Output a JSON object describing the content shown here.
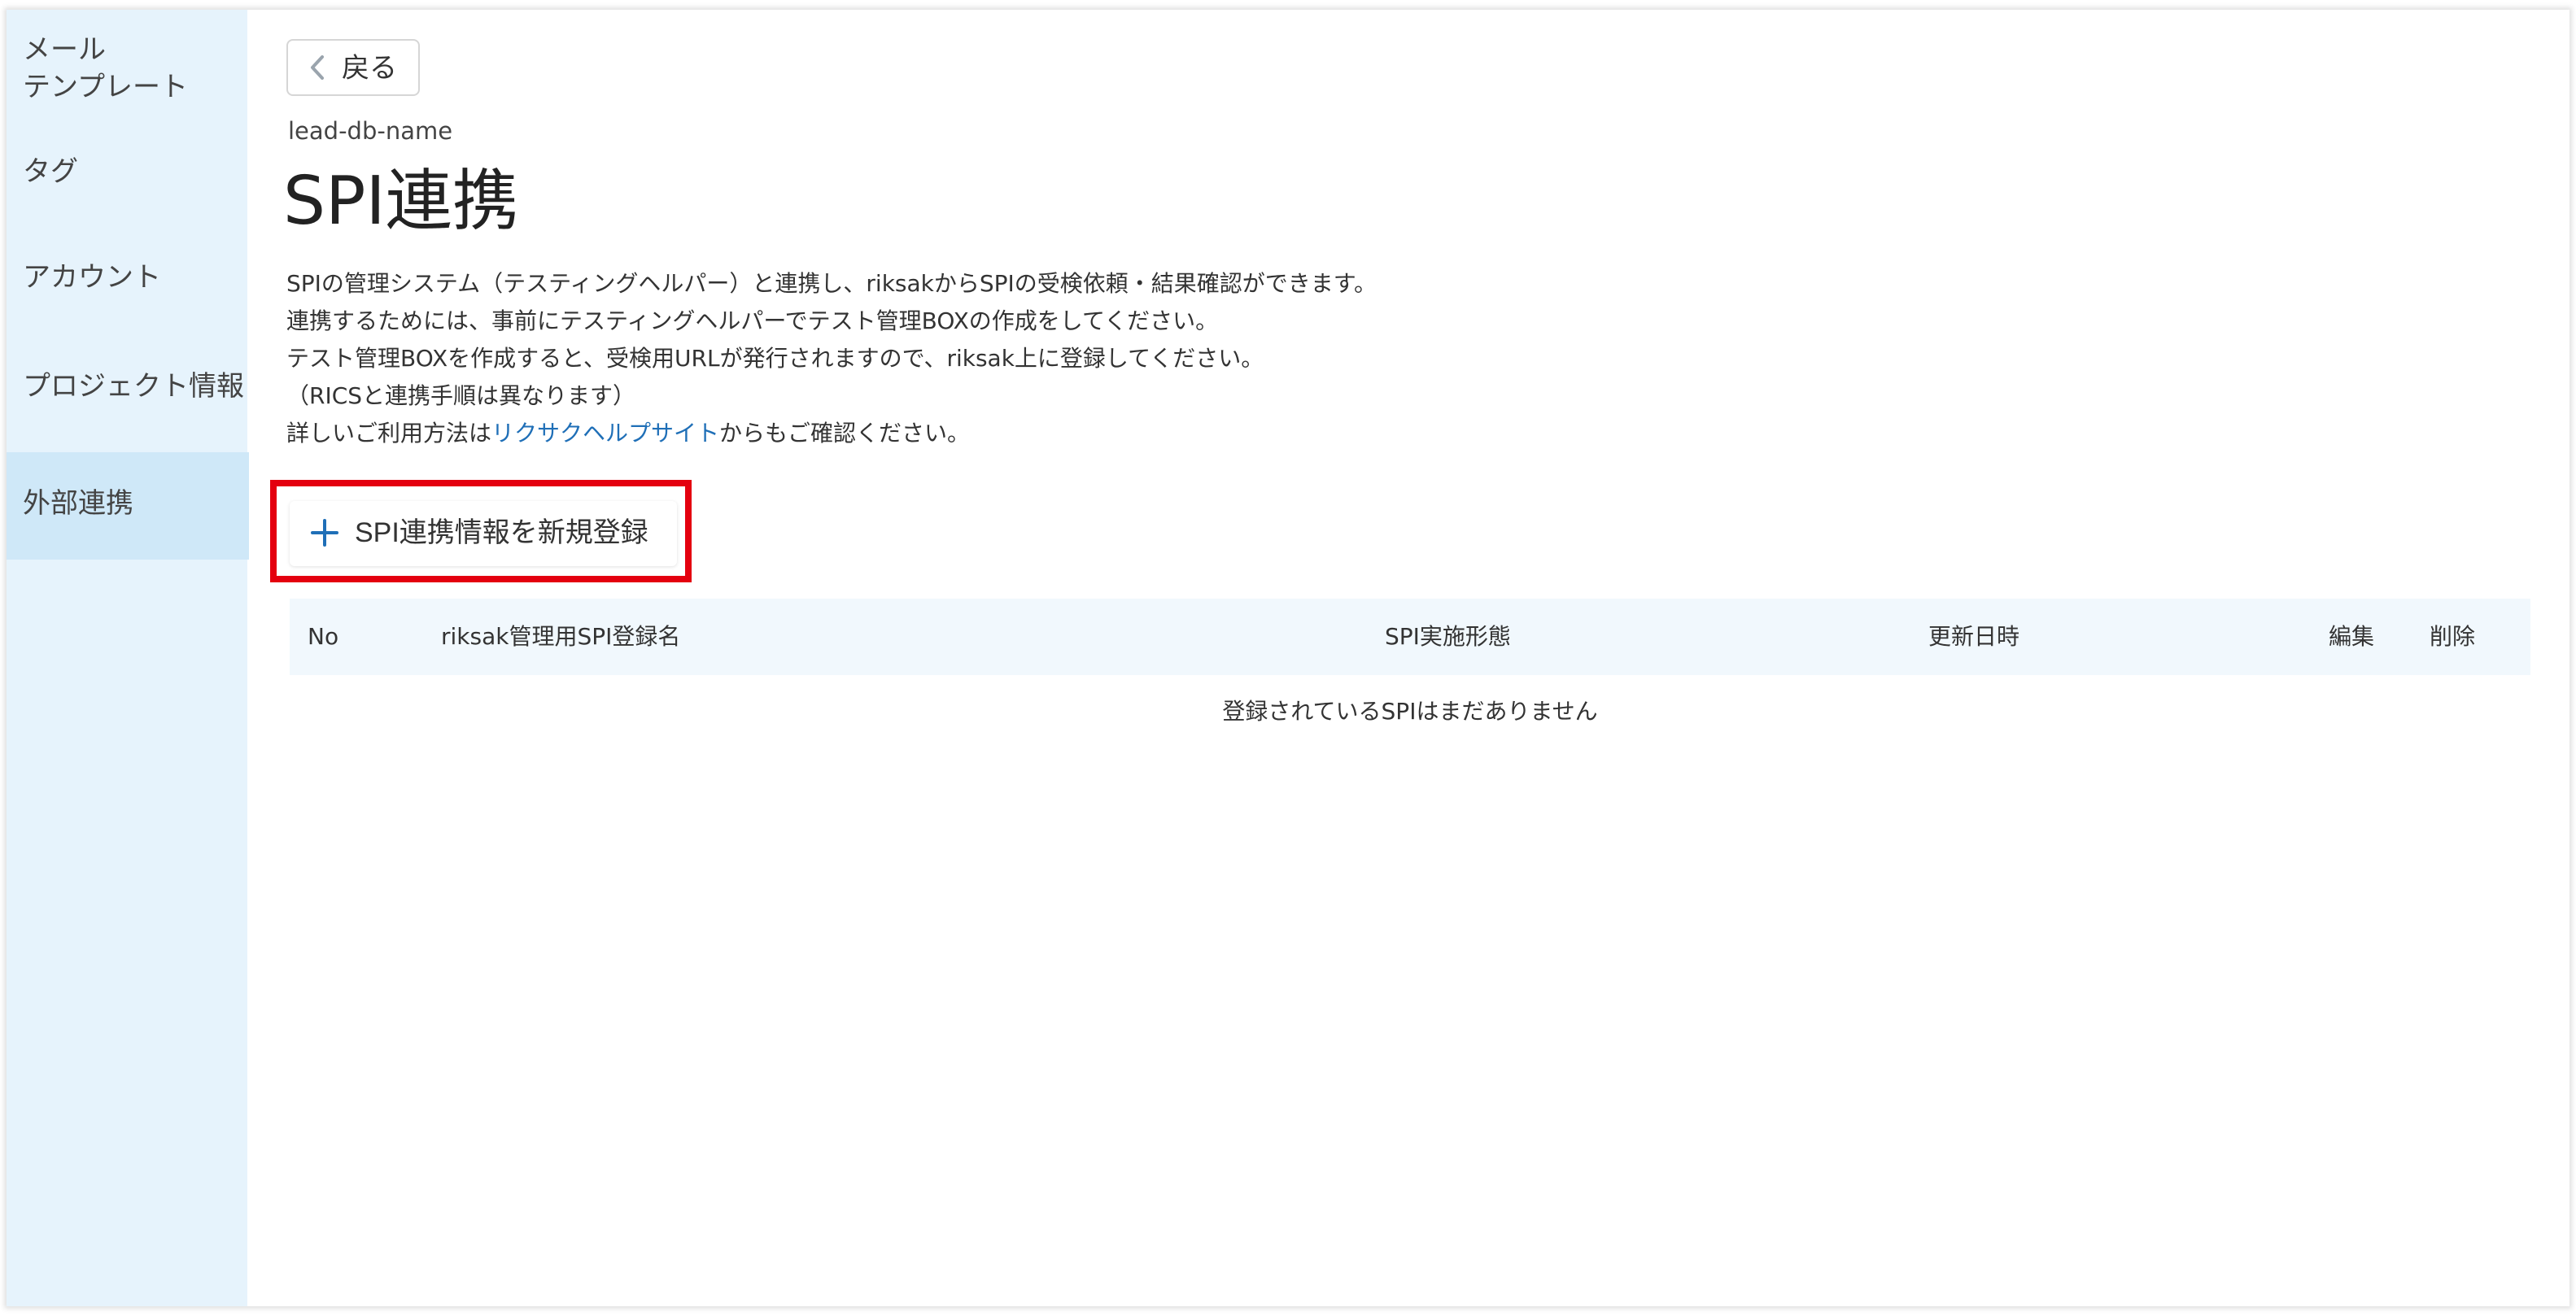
{
  "sidebar": {
    "items": [
      {
        "label": "メール\nテンプレート",
        "line1": "メール",
        "line2": "テンプレート"
      },
      {
        "label": "タグ"
      },
      {
        "label": "アカウント"
      },
      {
        "label": "プロジェクト情報"
      },
      {
        "label": "外部連携",
        "active": true
      }
    ]
  },
  "header": {
    "back_label": "戻る",
    "db_name": "lead-db-name",
    "title": "SPI連携"
  },
  "description": {
    "line1": "SPIの管理システム（テスティングヘルパー）と連携し、riksakからSPIの受検依頼・結果確認ができます。",
    "line2": "連携するためには、事前にテスティングヘルパーでテスト管理BOXの作成をしてください。",
    "line3": "テスト管理BOXを作成すると、受検用URLが発行されますので、riksak上に登録してください。",
    "line4": "（RICSと連携手順は異なります）",
    "line5_prefix": "詳しいご利用方法は",
    "line5_link": "リクサクヘルプサイト",
    "line5_suffix": "からもご確認ください。"
  },
  "actions": {
    "add_label": "SPI連携情報を新規登録"
  },
  "table": {
    "columns": [
      "No",
      "riksak管理用SPI登録名",
      "SPI実施形態",
      "更新日時",
      "編集",
      "削除"
    ],
    "empty_message": "登録されているSPIはまだありません"
  },
  "colors": {
    "sidebar_bg": "#e6f3fc",
    "sidebar_active": "#cfe8f8",
    "link": "#1f6fb7",
    "highlight": "#e4000f",
    "accent_plus": "#1f6fb7"
  },
  "icons": {
    "back": "chevron-left-icon",
    "add": "plus-icon"
  }
}
